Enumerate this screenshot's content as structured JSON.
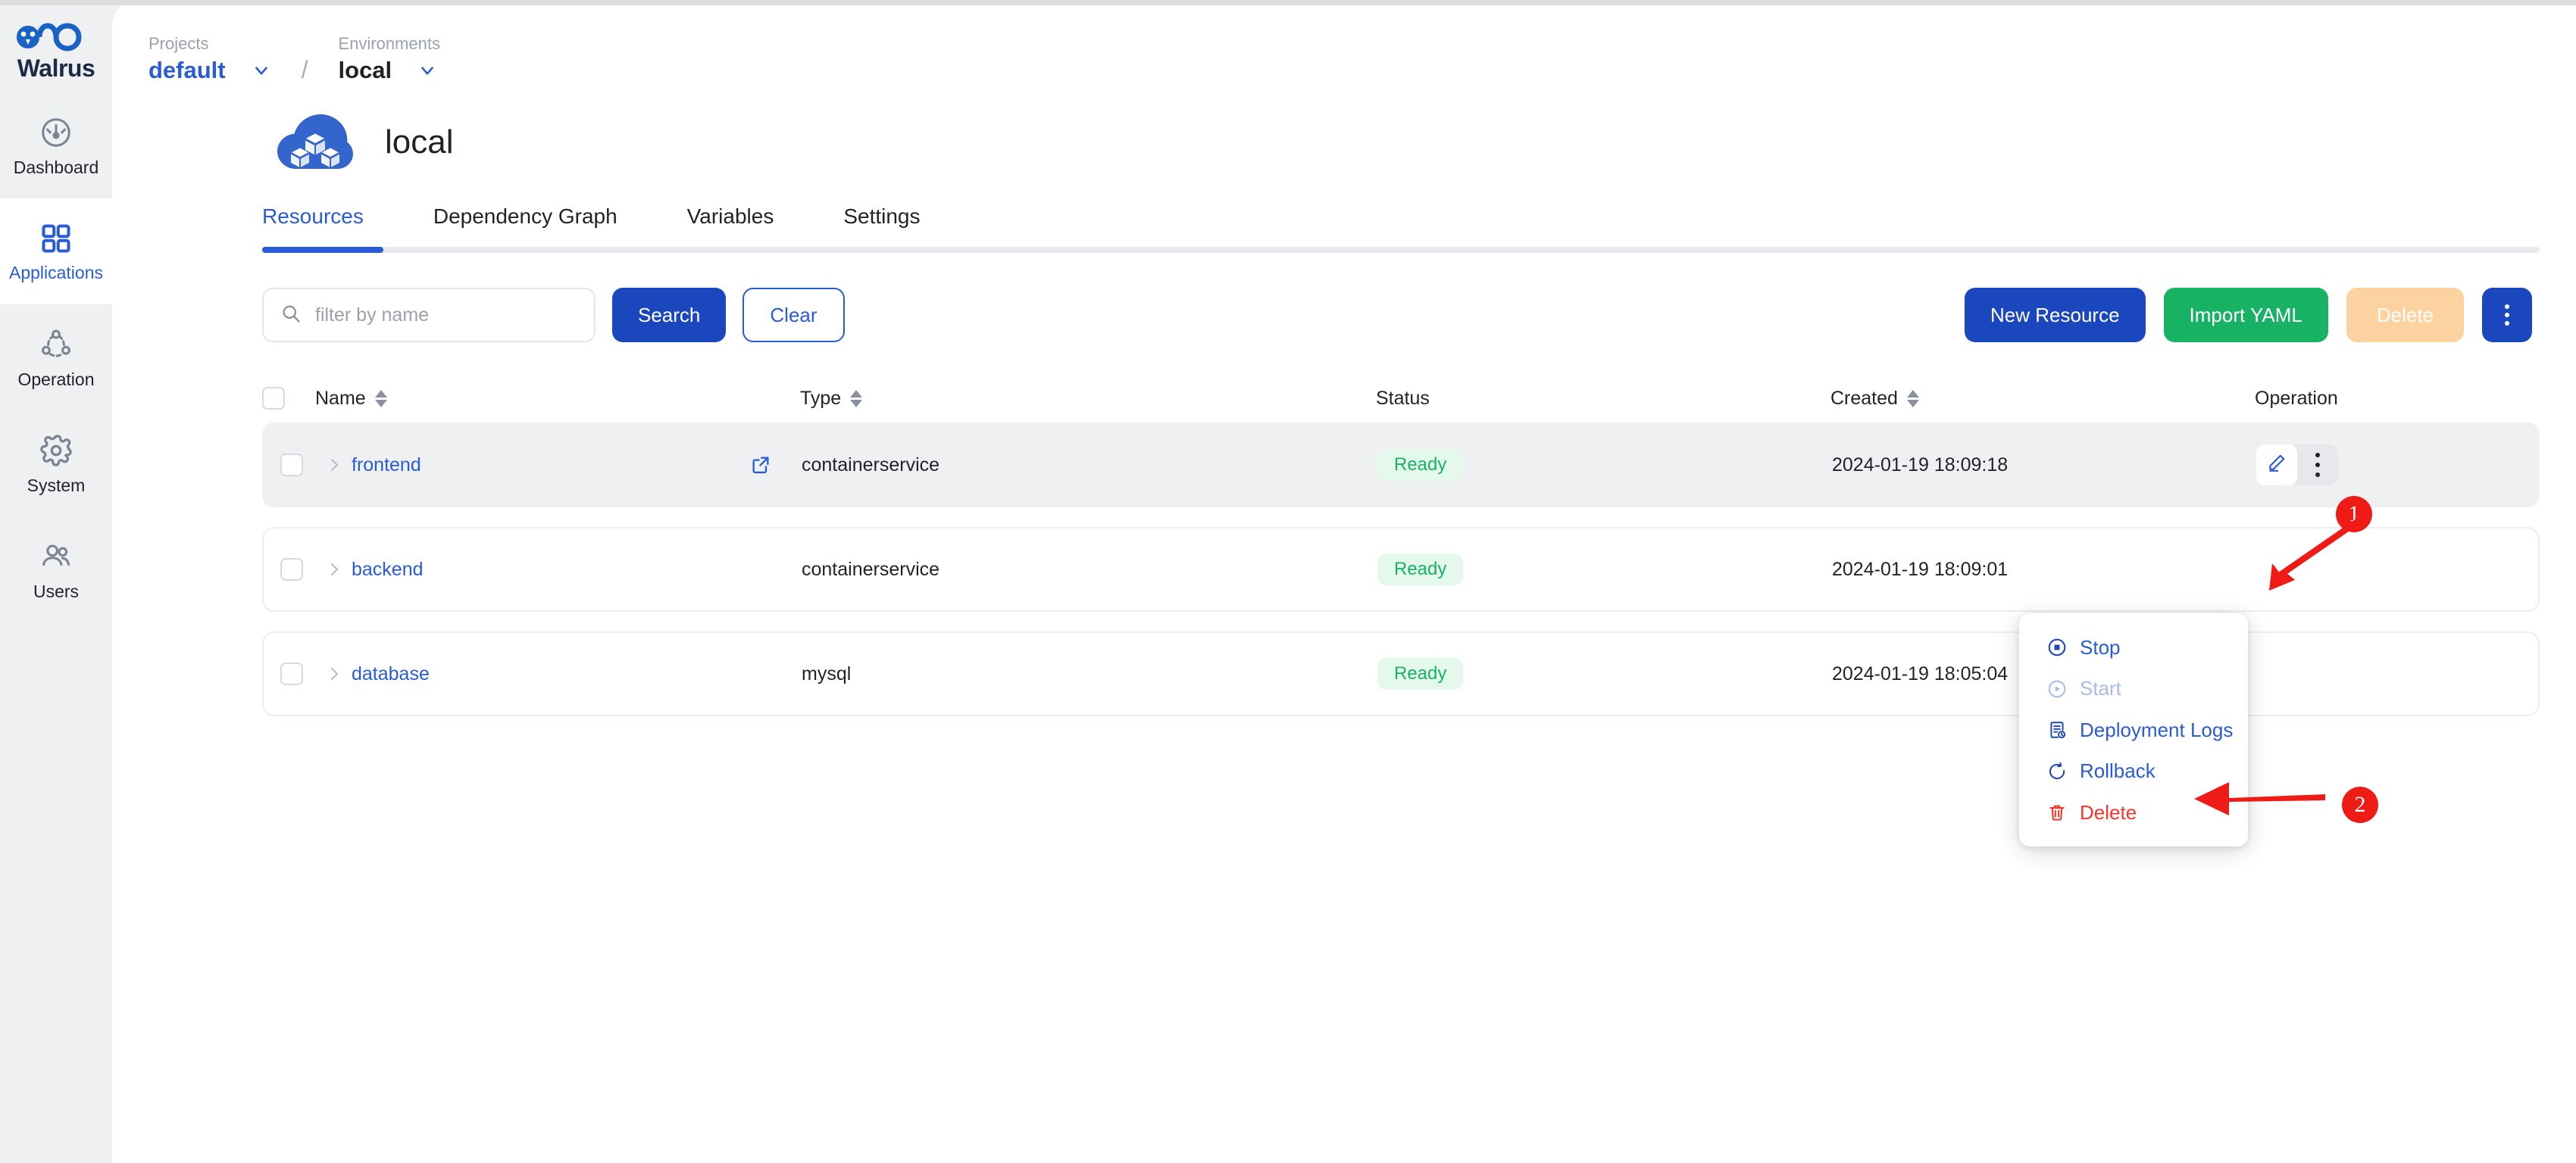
{
  "brand": {
    "name": "Walrus",
    "logo_icon": "walrus-infinity-logo"
  },
  "sidebar": {
    "items": [
      {
        "label": "Dashboard",
        "icon": "gauge-icon",
        "active": false
      },
      {
        "label": "Applications",
        "icon": "grid-squares-icon",
        "active": true
      },
      {
        "label": "Operation",
        "icon": "nodes-circle-icon",
        "active": false
      },
      {
        "label": "System",
        "icon": "gear-icon",
        "active": false
      },
      {
        "label": "Users",
        "icon": "users-icon",
        "active": false
      }
    ]
  },
  "breadcrumb": {
    "projects_label": "Projects",
    "projects_value": "default",
    "separator": "/",
    "environments_label": "Environments",
    "environments_value": "local"
  },
  "page": {
    "title": "local",
    "icon": "cloud-cubes-icon"
  },
  "tabs": [
    {
      "label": "Resources",
      "active": true
    },
    {
      "label": "Dependency Graph",
      "active": false
    },
    {
      "label": "Variables",
      "active": false
    },
    {
      "label": "Settings",
      "active": false
    }
  ],
  "toolbar": {
    "search_placeholder": "filter by name",
    "search_value": "",
    "search_icon": "search-icon",
    "search_button": "Search",
    "clear_button": "Clear",
    "new_resource_button": "New Resource",
    "import_yaml_button": "Import YAML",
    "delete_button": "Delete",
    "more_button_icon": "kebab-menu-icon"
  },
  "table": {
    "columns": [
      {
        "key": "name",
        "label": "Name",
        "sortable": true
      },
      {
        "key": "type",
        "label": "Type",
        "sortable": true
      },
      {
        "key": "status",
        "label": "Status",
        "sortable": false
      },
      {
        "key": "created",
        "label": "Created",
        "sortable": true
      },
      {
        "key": "op",
        "label": "Operation",
        "sortable": false
      }
    ],
    "rows": [
      {
        "name": "frontend",
        "type": "containerservice",
        "status": "Ready",
        "created": "2024-01-19 18:09:18",
        "has_external_link": true,
        "highlighted": true
      },
      {
        "name": "backend",
        "type": "containerservice",
        "status": "Ready",
        "created": "2024-01-19 18:09:01",
        "has_external_link": false,
        "highlighted": false
      },
      {
        "name": "database",
        "type": "mysql",
        "status": "Ready",
        "created": "2024-01-19 18:05:04",
        "has_external_link": false,
        "highlighted": false
      }
    ]
  },
  "context_menu": {
    "items": [
      {
        "label": "Stop",
        "icon": "stop-circle-icon",
        "state": "enabled"
      },
      {
        "label": "Start",
        "icon": "play-circle-icon",
        "state": "disabled"
      },
      {
        "label": "Deployment Logs",
        "icon": "logs-clock-icon",
        "state": "enabled"
      },
      {
        "label": "Rollback",
        "icon": "rotate-ccw-icon",
        "state": "enabled"
      },
      {
        "label": "Delete",
        "icon": "trash-icon",
        "state": "danger"
      }
    ]
  },
  "annotations": [
    {
      "number": "1"
    },
    {
      "number": "2"
    }
  ],
  "colors": {
    "accent_blue": "#2a5bd7",
    "primary_button": "#1a46be",
    "success_green": "#18b265",
    "badge_bg": "#e4f8ec",
    "delete_disabled": "#fbd2a0",
    "danger_red": "#f4372a",
    "annotation_red": "#ef1b16",
    "sidebar_bg": "#eff0f2"
  }
}
